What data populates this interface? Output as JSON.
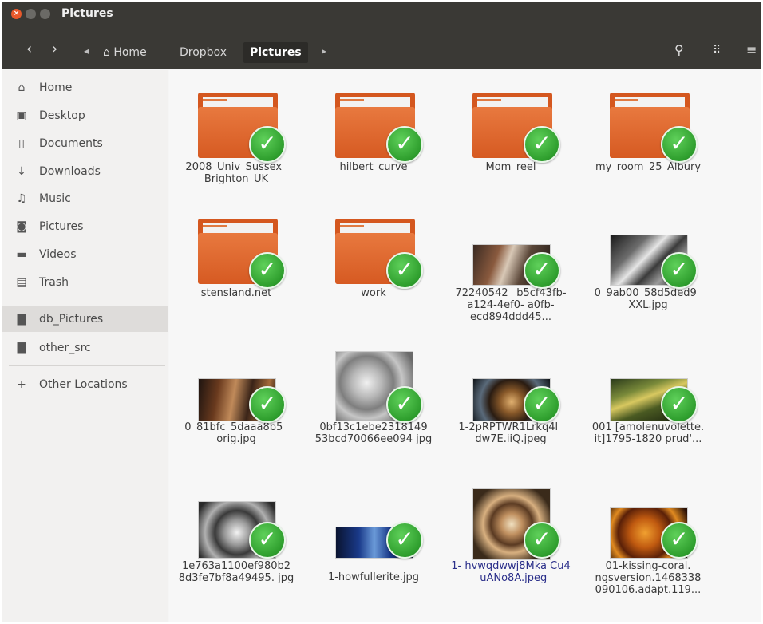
{
  "window": {
    "title": "Pictures"
  },
  "header": {
    "breadcrumbs": [
      "Home",
      "Dropbox",
      "Pictures"
    ],
    "back_glyph": "‹",
    "forward_glyph": "›",
    "search_icon": "search-icon",
    "view_icon": "grid-view-icon",
    "menu_icon": "menu-icon"
  },
  "sidebar": {
    "items": [
      {
        "label": "Home",
        "icon": "home-icon"
      },
      {
        "label": "Desktop",
        "icon": "desktop-icon"
      },
      {
        "label": "Documents",
        "icon": "documents-icon"
      },
      {
        "label": "Downloads",
        "icon": "downloads-icon"
      },
      {
        "label": "Music",
        "icon": "music-icon"
      },
      {
        "label": "Pictures",
        "icon": "pictures-icon"
      },
      {
        "label": "Videos",
        "icon": "videos-icon"
      },
      {
        "label": "Trash",
        "icon": "trash-icon"
      }
    ],
    "bookmarks": [
      {
        "label": "db_Pictures",
        "icon": "folder-icon"
      },
      {
        "label": "other_src",
        "icon": "folder-icon"
      }
    ],
    "other_locations": "Other Locations"
  },
  "files": [
    {
      "name": "2008_Univ_Sussex_ Brighton_UK",
      "kind": "folder"
    },
    {
      "name": "hilbert_curve",
      "kind": "folder"
    },
    {
      "name": "Mom_reel",
      "kind": "folder"
    },
    {
      "name": "my_room_25_Albury",
      "kind": "folder"
    },
    {
      "name": "stensland.net",
      "kind": "folder"
    },
    {
      "name": "work",
      "kind": "folder"
    },
    {
      "name": "72240542_ b5cf43fb-a124-4ef0- a0fb-ecd894ddd45...",
      "kind": "image"
    },
    {
      "name": "0_9ab00_58d5ded9_ XXL.jpg",
      "kind": "image"
    },
    {
      "name": "0_81bfc_5daaa8b5_ orig.jpg",
      "kind": "image"
    },
    {
      "name": "0bf13c1ebe2318149 53bcd70066ee094 jpg",
      "kind": "image"
    },
    {
      "name": "1-2pRPTWR1Lrkq4l_ dw7E.iiQ.jpeg",
      "kind": "image"
    },
    {
      "name": "001 [amolenuvolette. it]1795-1820 prud'...",
      "kind": "image"
    },
    {
      "name": "1e763a1100ef980b2 8d3fe7bf8a49495. jpg",
      "kind": "image"
    },
    {
      "name": "1-howfullerite.jpg",
      "kind": "image"
    },
    {
      "name": "1- hvwqdwwj8Mka Cu4 _uANo8A.jpeg",
      "kind": "image"
    },
    {
      "name": "01-kissing-coral. ngsversion.1468338 090106.adapt.119...",
      "kind": "image"
    }
  ],
  "sync_status": "synced-check-icon"
}
